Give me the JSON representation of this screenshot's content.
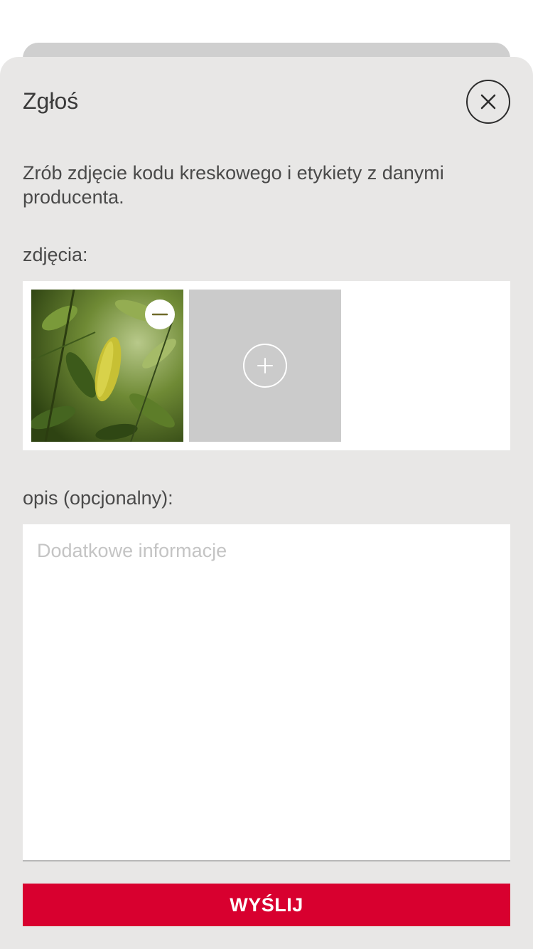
{
  "modal": {
    "title": "Zgłoś",
    "close_icon": "close-icon",
    "instruction": "Zrób zdjęcie kodu kreskowego i etykiety z danymi producenta."
  },
  "photos": {
    "label": "zdjęcia:",
    "items": [
      {
        "remove_icon": "minus-icon"
      }
    ],
    "add_icon": "plus-icon"
  },
  "description": {
    "label": "opis (opcjonalny):",
    "value": "",
    "placeholder": "Dodatkowe informacje"
  },
  "submit": {
    "label": "WYŚLIJ"
  },
  "colors": {
    "sheet_bg": "#e8e7e6",
    "accent": "#d8002f",
    "text": "#4a4a4a",
    "placeholder": "#c4c4c4",
    "add_tile": "#cbcbcb"
  }
}
